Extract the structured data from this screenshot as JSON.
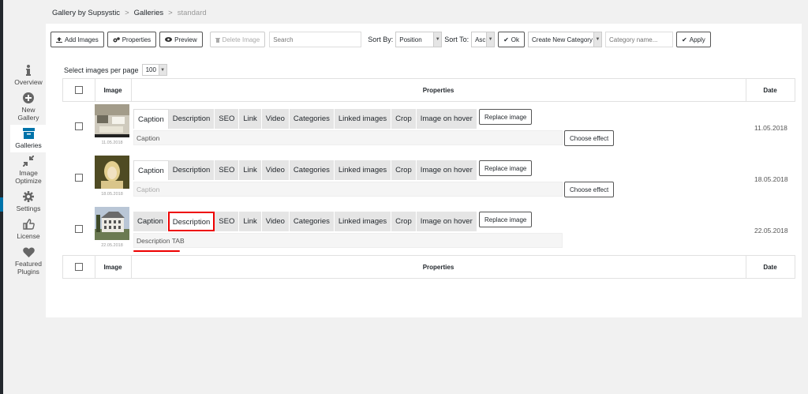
{
  "breadcrumb": {
    "root": "Gallery by Supsystic",
    "section": "Galleries",
    "current": "standard",
    "separator": ">"
  },
  "sidebar": {
    "items": [
      {
        "label": "Overview",
        "icon": "info-icon"
      },
      {
        "label": "New Gallery",
        "icon": "plus-circle-icon"
      },
      {
        "label": "Galleries",
        "icon": "archive-box-icon",
        "active": true
      },
      {
        "label": "Image Optimize",
        "icon": "compress-arrows-icon"
      },
      {
        "label": "Settings",
        "icon": "gear-icon"
      },
      {
        "label": "License",
        "icon": "thumbs-up-icon"
      },
      {
        "label": "Featured Plugins",
        "icon": "heart-icon"
      }
    ]
  },
  "toolbar": {
    "add_images": "Add Images",
    "properties": "Properties",
    "preview": "Preview",
    "delete_image": "Delete Image",
    "search_placeholder": "Search",
    "sort_by_label": "Sort By:",
    "sort_by_value": "Position",
    "sort_to_label": "Sort To:",
    "sort_to_value": "Asc",
    "ok": "Ok",
    "category_select": "Create New Category",
    "category_placeholder": "Category name...",
    "apply": "Apply"
  },
  "per_page": {
    "label": "Select images per page",
    "value": "100"
  },
  "table": {
    "columns": {
      "image": "Image",
      "properties": "Properties",
      "date": "Date"
    }
  },
  "tab_labels": [
    "Caption",
    "Description",
    "SEO",
    "Link",
    "Video",
    "Categories",
    "Linked images",
    "Crop",
    "Image on hover"
  ],
  "replace_image": "Replace image",
  "choose_effect": "Choose effect",
  "rows": [
    {
      "thumb_date": "11.05.2018",
      "date": "11.05.2018",
      "active_tab": 0,
      "field_text": "Caption",
      "placeholder": false,
      "show_effect": true
    },
    {
      "thumb_date": "18.05.2018",
      "date": "18.05.2018",
      "active_tab": 0,
      "field_text": "Caption",
      "placeholder": true,
      "show_effect": true
    },
    {
      "thumb_date": "22.05.2018",
      "date": "22.05.2018",
      "active_tab": 1,
      "field_text": "Description TAB",
      "placeholder": false,
      "show_effect": false
    }
  ],
  "colors": {
    "highlight": "#e00000",
    "sidebar_active": "#0073aa",
    "panel_bg": "#ffffff",
    "page_bg": "#f1f1f1"
  }
}
